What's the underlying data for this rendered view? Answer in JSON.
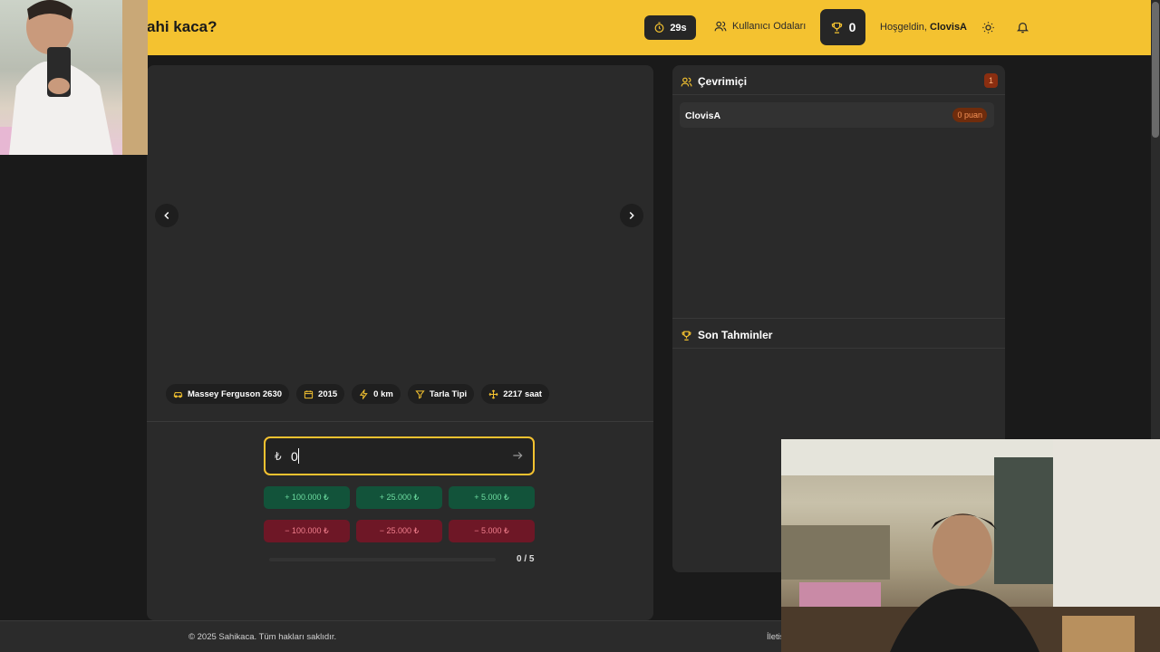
{
  "header": {
    "brand_title": "ahi kaca?",
    "timer": "29s",
    "rooms_label": "Kullanıcı Odaları",
    "score": "0",
    "welcome_prefix": "Hoşgeldin,",
    "username": "ClovisA"
  },
  "vehicle": {
    "specs": [
      {
        "icon": "car-icon",
        "label": "Massey Ferguson 2630"
      },
      {
        "icon": "calendar-icon",
        "label": "2015"
      },
      {
        "icon": "gauge-icon",
        "label": "0 km"
      },
      {
        "icon": "filter-icon",
        "label": "Tarla Tipi"
      },
      {
        "icon": "move-icon",
        "label": "2217 saat"
      }
    ]
  },
  "bid": {
    "currency": "₺",
    "value": "0",
    "increments": [
      "+ 100.000 ₺",
      "+ 25.000 ₺",
      "+ 5.000 ₺"
    ],
    "decrements": [
      "− 100.000 ₺",
      "− 25.000 ₺",
      "− 5.000 ₺"
    ],
    "progress_text": "0 / 5",
    "progress": 0
  },
  "online": {
    "title": "Çevrimiçi",
    "count": "1",
    "users": [
      {
        "name": "ClovisA",
        "points": "0 puan"
      }
    ]
  },
  "recent": {
    "title": "Son Tahminler"
  },
  "footer": {
    "copyright": "© 2025 Sahikaca. Tüm hakları saklıdır.",
    "contact": "İletiş"
  },
  "colors": {
    "accent": "#f4c230",
    "panel": "#2a2a2a",
    "plus": "#12533a",
    "minus": "#6e1726"
  }
}
